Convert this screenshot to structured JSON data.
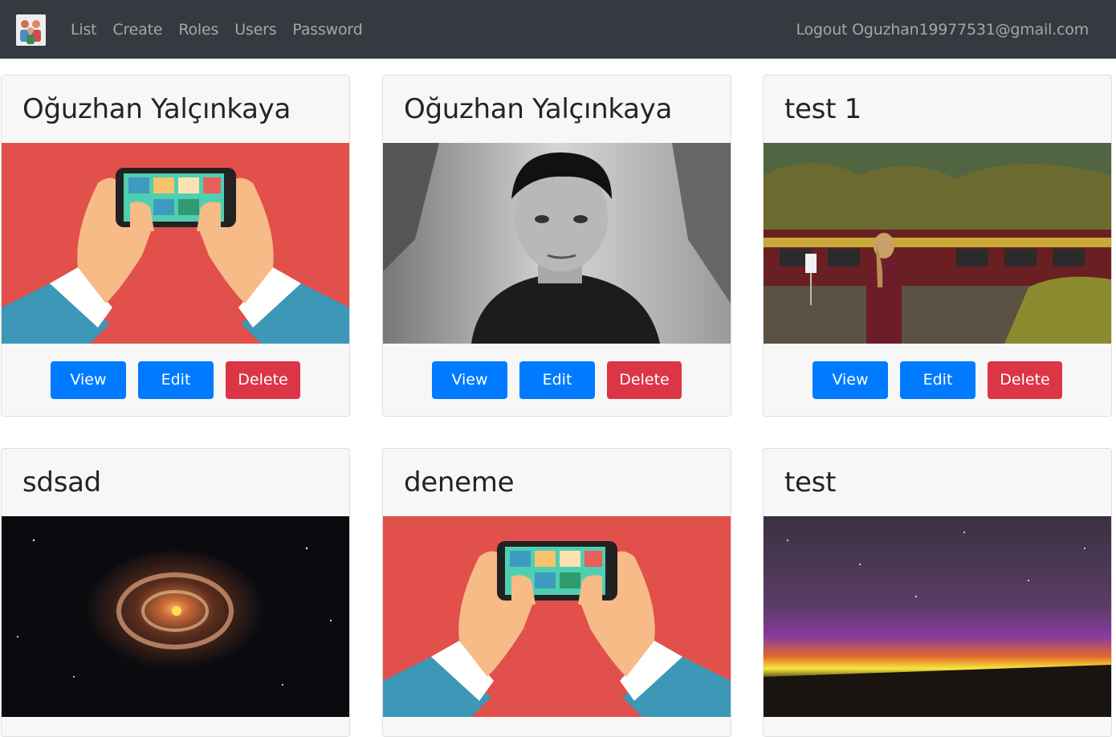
{
  "navbar": {
    "logo_icon": "users-logo-icon",
    "links": [
      "List",
      "Create",
      "Roles",
      "Users",
      "Password"
    ],
    "logout_label": "Logout Oguzhan19977531@gmail.com"
  },
  "colors": {
    "navbar_bg": "#343a40",
    "primary": "#007bff",
    "danger": "#dc3545"
  },
  "cards": [
    {
      "title": "Oğuzhan Yalçınkaya",
      "image": "phone-hands-illustration",
      "view": "View",
      "edit": "Edit",
      "delete": "Delete"
    },
    {
      "title": "Oğuzhan Yalçınkaya",
      "image": "grayscale-portrait-photo",
      "view": "View",
      "edit": "Edit",
      "delete": "Delete"
    },
    {
      "title": "test 1",
      "image": "woman-by-train-photo",
      "view": "View",
      "edit": "Edit",
      "delete": "Delete"
    },
    {
      "title": "sdsad",
      "image": "galaxy-space-photo",
      "image_only": true
    },
    {
      "title": "deneme",
      "image": "phone-hands-illustration",
      "image_only": true
    },
    {
      "title": "test",
      "image": "aurora-night-sky-photo",
      "image_only": true
    }
  ]
}
